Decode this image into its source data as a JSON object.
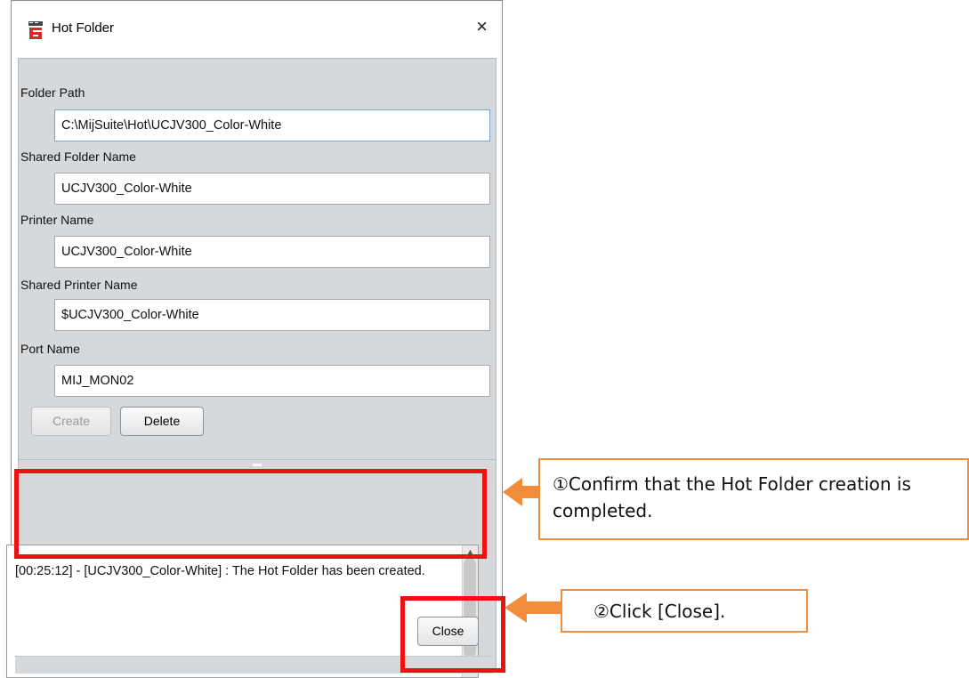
{
  "window": {
    "title": "Hot Folder",
    "icon": "app-logo-icon",
    "close_glyph": "×"
  },
  "form": {
    "fields": [
      {
        "label": "Folder Path",
        "value": "C:\\MijSuite\\Hot\\UCJV300_Color-White"
      },
      {
        "label": "Shared Folder Name",
        "value": "UCJV300_Color-White"
      },
      {
        "label": "Printer Name",
        "value": "UCJV300_Color-White"
      },
      {
        "label": "Shared Printer Name",
        "value": "$UCJV300_Color-White"
      },
      {
        "label": "Port Name",
        "value": "MIJ_MON02"
      }
    ],
    "create_label": "Create",
    "delete_label": "Delete"
  },
  "log": {
    "text": "[00:25:12] - [UCJV300_Color-White] : The Hot Folder has been created."
  },
  "footer": {
    "close_label": "Close"
  },
  "annotations": {
    "callout1": "①Confirm that the Hot Folder creation is completed.",
    "callout2": "②Click [Close].",
    "highlight_color": "#ee1111",
    "callout_color": "#f08c3a"
  }
}
